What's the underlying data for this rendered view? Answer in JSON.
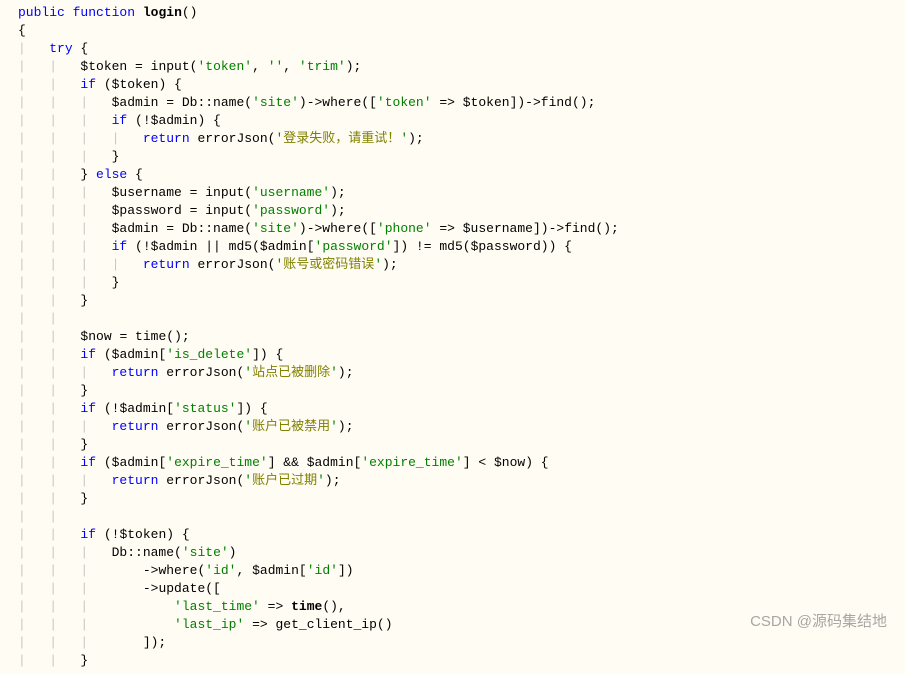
{
  "watermark": "CSDN @源码集结地",
  "t": {
    "public": "public",
    "function": "function",
    "try": "try",
    "if": "if",
    "else": "else",
    "return": "return",
    "login": "login",
    "token_var": "$token",
    "admin_var": "$admin",
    "username_var": "$username",
    "password_var": "$password",
    "now_var": "$now",
    "input": "input",
    "db_name": "Db::name",
    "where": "where",
    "find": "find",
    "errorJson": "errorJson",
    "md5": "md5",
    "time": "time",
    "update": "update",
    "get_client_ip": "get_client_ip",
    "s_token": "'token'",
    "s_empty": "''",
    "s_trim": "'trim'",
    "s_site": "'site'",
    "s_username": "'username'",
    "s_password": "'password'",
    "s_phone": "'phone'",
    "s_is_delete": "'is_delete'",
    "s_status": "'status'",
    "s_expire_time": "'expire_time'",
    "s_id": "'id'",
    "s_last_time": "'last_time'",
    "s_last_ip": "'last_ip'",
    "msg_login_fail": "登录失败，请重试！",
    "msg_cred_err": "账号或密码错误",
    "msg_site_del": "站点已被删除",
    "msg_acct_ban": "账户已被禁用",
    "msg_acct_exp": "账户已过期"
  }
}
